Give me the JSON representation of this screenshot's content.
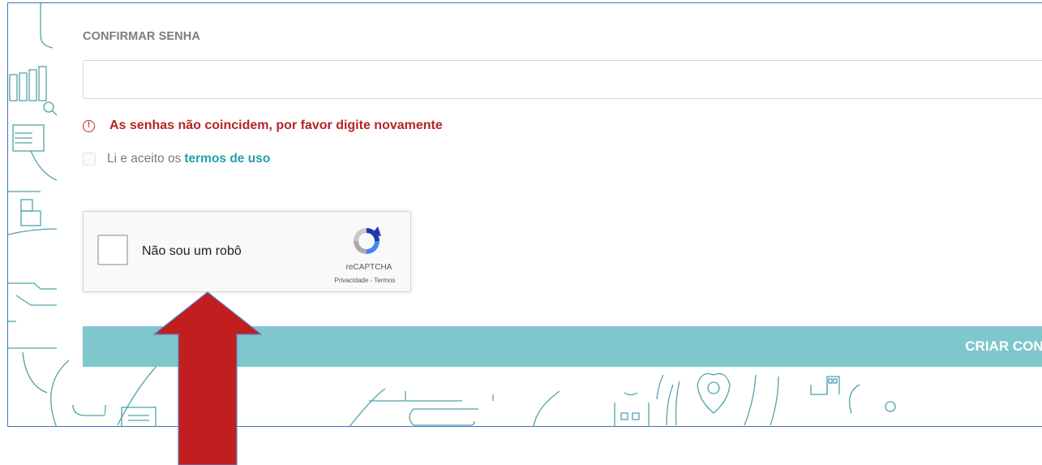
{
  "form": {
    "confirm_label": "CONFIRMAR SENHA",
    "confirm_value": "",
    "error_message": "As senhas não coincidem, por favor digite novamente",
    "error_icon_glyph": "!",
    "terms_prefix": "Li e aceito os",
    "terms_link": "termos de uso",
    "terms_checked": false
  },
  "recaptcha": {
    "label": "Não sou um robô",
    "brand": "reCAPTCHA",
    "links": "Privacidade - Termos",
    "checked": false
  },
  "submit": {
    "label": "CRIAR CONTA"
  },
  "colors": {
    "accent": "#24a0a8",
    "button": "#7fc7cc",
    "error": "#b52525",
    "arrow": "#c11f1f",
    "frame_border": "#4472c4"
  }
}
